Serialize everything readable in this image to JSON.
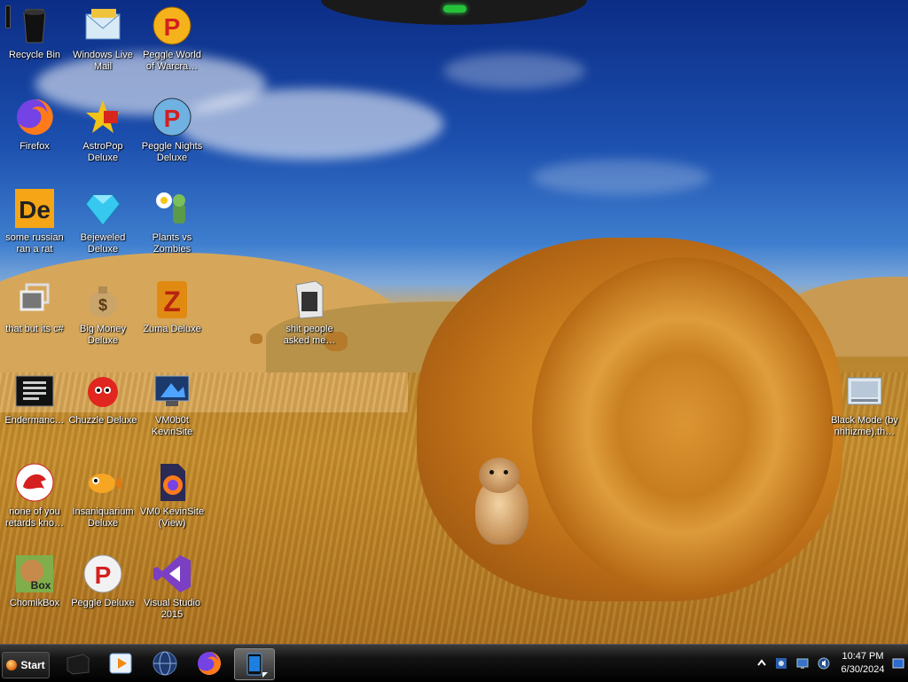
{
  "desktop": {
    "icons": [
      {
        "label": "Recycle Bin",
        "icon": "recycle-bin-icon"
      },
      {
        "label": "Windows Live Mail",
        "icon": "mail-icon"
      },
      {
        "label": "Peggle World of Warcra…",
        "icon": "peggle-icon"
      },
      {
        "label": "Firefox",
        "icon": "firefox-icon"
      },
      {
        "label": "AstroPop Deluxe",
        "icon": "astropop-icon"
      },
      {
        "label": "Peggle Nights Deluxe",
        "icon": "peggle-nights-icon"
      },
      {
        "label": "some russian ran a rat",
        "icon": "de-app-icon"
      },
      {
        "label": "Bejeweled Deluxe",
        "icon": "gem-icon"
      },
      {
        "label": "Plants vs Zombies",
        "icon": "flower-icon"
      },
      {
        "label": "that but its c#",
        "icon": "windows-stack-icon"
      },
      {
        "label": "Big Money Deluxe",
        "icon": "money-bag-icon"
      },
      {
        "label": "Zuma Deluxe",
        "icon": "zuma-icon"
      },
      {
        "label": "shit people asked me…",
        "icon": "folder-icon"
      },
      {
        "label": "Endermanc…",
        "icon": "terminal-icon"
      },
      {
        "label": "Chuzzle Deluxe",
        "icon": "chuzzle-icon"
      },
      {
        "label": "VM0b0t KevinSite",
        "icon": "vm-monitor-icon"
      },
      {
        "label": "Black Mode (by nhhizme).th…",
        "icon": "theme-file-icon"
      },
      {
        "label": "none of you retards kno…",
        "icon": "dragon-icon"
      },
      {
        "label": "Insaniquarium Deluxe",
        "icon": "fish-icon"
      },
      {
        "label": "VM0 KevinSite (View)",
        "icon": "firefox-file-icon"
      },
      {
        "label": "ChomikBox",
        "icon": "hamster-box-icon"
      },
      {
        "label": "Peggle Deluxe",
        "icon": "peggle-icon"
      },
      {
        "label": "Visual Studio 2015",
        "icon": "visual-studio-icon"
      }
    ]
  },
  "taskbar": {
    "start_label": "Start",
    "pinned": [
      {
        "icon": "black-box-icon"
      },
      {
        "icon": "media-player-icon"
      },
      {
        "icon": "globe-icon"
      },
      {
        "icon": "firefox-icon"
      },
      {
        "icon": "tablet-icon",
        "active": true
      }
    ],
    "tray_icons": [
      "chevron-up-icon",
      "security-icon",
      "network-icon",
      "volume-icon",
      "show-desktop-icon"
    ],
    "time": "10:47 PM",
    "date": "6/30/2024"
  },
  "colors": {
    "sky": "#1c4fae",
    "field": "#c48c2c",
    "taskbar": "#141414"
  }
}
